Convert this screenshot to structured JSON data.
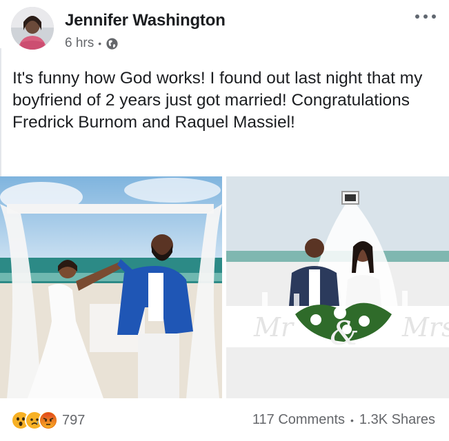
{
  "post": {
    "author": "Jennifer Washington",
    "timestamp": "6 hrs",
    "privacy_icon": "globe-icon",
    "more_icon": "ellipsis-icon",
    "text": "It's funny how God works! I found out last night that my boyfriend of 2 years just got married! Congratulations Fredrick Burnom and Raquel Massiel!",
    "photos": [
      {
        "name": "wedding-photo-couple-walking"
      },
      {
        "name": "wedding-photo-couple-seated"
      }
    ],
    "photo_lettering": "Mr & Mrs",
    "reactions": {
      "icons": [
        "wow-reaction-icon",
        "sad-reaction-icon",
        "angry-reaction-icon"
      ],
      "count": "797"
    },
    "comments": "117 Comments",
    "shares": "1.3K Shares"
  },
  "colors": {
    "text": "#1c1e21",
    "secondary": "#65676b",
    "wow": "#f7b125",
    "angry": "#e9710f"
  }
}
